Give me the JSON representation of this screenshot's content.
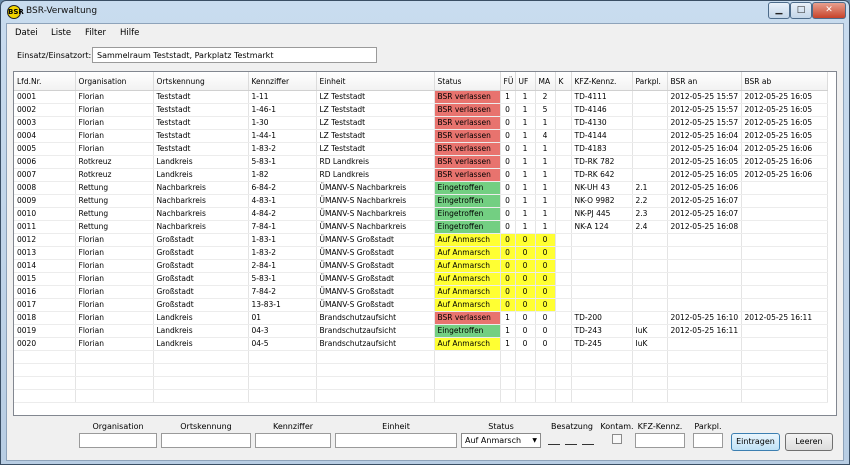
{
  "window": {
    "title": "BSR-Verwaltung",
    "app_icon_label": "BSR"
  },
  "menu": [
    "Datei",
    "Liste",
    "Filter",
    "Hilfe"
  ],
  "einsatz": {
    "label": "Einsatz/Einsatzort:",
    "value": "Sammelraum Teststadt, Parkplatz Testmarkt"
  },
  "table": {
    "columns": [
      "Lfd.Nr.",
      "Organisation",
      "Ortskennung",
      "Kennziffer",
      "Einheit",
      "Status",
      "FÜ",
      "UF",
      "MA",
      "K",
      "KFZ-Kennz.",
      "Parkpl.",
      "BSR an",
      "BSR ab"
    ],
    "rows": [
      {
        "nr": "0001",
        "org": "Florian",
        "ort": "Teststadt",
        "kz": "1-11",
        "einheit": "LZ Teststadt",
        "status": "BSR verlassen",
        "fue": "1",
        "uf": "1",
        "ma": "2",
        "k": "",
        "kfz": "TD-4111",
        "park": "",
        "an": "2012-05-25 15:57",
        "ab": "2012-05-25 16:05"
      },
      {
        "nr": "0002",
        "org": "Florian",
        "ort": "Teststadt",
        "kz": "1-46-1",
        "einheit": "LZ Teststadt",
        "status": "BSR verlassen",
        "fue": "0",
        "uf": "1",
        "ma": "5",
        "k": "",
        "kfz": "TD-4146",
        "park": "",
        "an": "2012-05-25 15:57",
        "ab": "2012-05-25 16:05"
      },
      {
        "nr": "0003",
        "org": "Florian",
        "ort": "Teststadt",
        "kz": "1-30",
        "einheit": "LZ Teststadt",
        "status": "BSR verlassen",
        "fue": "0",
        "uf": "1",
        "ma": "1",
        "k": "",
        "kfz": "TD-4130",
        "park": "",
        "an": "2012-05-25 15:57",
        "ab": "2012-05-25 16:05"
      },
      {
        "nr": "0004",
        "org": "Florian",
        "ort": "Teststadt",
        "kz": "1-44-1",
        "einheit": "LZ Teststadt",
        "status": "BSR verlassen",
        "fue": "0",
        "uf": "1",
        "ma": "4",
        "k": "",
        "kfz": "TD-4144",
        "park": "",
        "an": "2012-05-25 16:04",
        "ab": "2012-05-25 16:05"
      },
      {
        "nr": "0005",
        "org": "Florian",
        "ort": "Teststadt",
        "kz": "1-83-2",
        "einheit": "LZ Teststadt",
        "status": "BSR verlassen",
        "fue": "0",
        "uf": "1",
        "ma": "1",
        "k": "",
        "kfz": "TD-4183",
        "park": "",
        "an": "2012-05-25 16:04",
        "ab": "2012-05-25 16:06"
      },
      {
        "nr": "0006",
        "org": "Rotkreuz",
        "ort": "Landkreis",
        "kz": "5-83-1",
        "einheit": "RD Landkreis",
        "status": "BSR verlassen",
        "fue": "0",
        "uf": "1",
        "ma": "1",
        "k": "",
        "kfz": "TD-RK 782",
        "park": "",
        "an": "2012-05-25 16:05",
        "ab": "2012-05-25 16:06"
      },
      {
        "nr": "0007",
        "org": "Rotkreuz",
        "ort": "Landkreis",
        "kz": "1-82",
        "einheit": "RD Landkreis",
        "status": "BSR verlassen",
        "fue": "0",
        "uf": "1",
        "ma": "1",
        "k": "",
        "kfz": "TD-RK 642",
        "park": "",
        "an": "2012-05-25 16:05",
        "ab": "2012-05-25 16:06"
      },
      {
        "nr": "0008",
        "org": "Rettung",
        "ort": "Nachbarkreis",
        "kz": "6-84-2",
        "einheit": "ÜMANV-S Nachbarkreis",
        "status": "Eingetroffen",
        "fue": "0",
        "uf": "1",
        "ma": "1",
        "k": "",
        "kfz": "NK-UH 43",
        "park": "2.1",
        "an": "2012-05-25 16:06",
        "ab": ""
      },
      {
        "nr": "0009",
        "org": "Rettung",
        "ort": "Nachbarkreis",
        "kz": "4-83-1",
        "einheit": "ÜMANV-S Nachbarkreis",
        "status": "Eingetroffen",
        "fue": "0",
        "uf": "1",
        "ma": "1",
        "k": "",
        "kfz": "NK-O 9982",
        "park": "2.2",
        "an": "2012-05-25 16:07",
        "ab": ""
      },
      {
        "nr": "0010",
        "org": "Rettung",
        "ort": "Nachbarkreis",
        "kz": "4-84-2",
        "einheit": "ÜMANV-S Nachbarkreis",
        "status": "Eingetroffen",
        "fue": "0",
        "uf": "1",
        "ma": "1",
        "k": "",
        "kfz": "NK-PJ 445",
        "park": "2.3",
        "an": "2012-05-25 16:07",
        "ab": ""
      },
      {
        "nr": "0011",
        "org": "Rettung",
        "ort": "Nachbarkreis",
        "kz": "7-84-1",
        "einheit": "ÜMANV-S Nachbarkreis",
        "status": "Eingetroffen",
        "fue": "0",
        "uf": "1",
        "ma": "1",
        "k": "",
        "kfz": "NK-A 124",
        "park": "2.4",
        "an": "2012-05-25 16:08",
        "ab": ""
      },
      {
        "nr": "0012",
        "org": "Florian",
        "ort": "Großstadt",
        "kz": "1-83-1",
        "einheit": "ÜMANV-S Großstadt",
        "status": "Auf Anmarsch",
        "fue": "0",
        "uf": "0",
        "ma": "0",
        "k": "",
        "kfz": "",
        "park": "",
        "an": "",
        "ab": ""
      },
      {
        "nr": "0013",
        "org": "Florian",
        "ort": "Großstadt",
        "kz": "1-83-2",
        "einheit": "ÜMANV-S Großstadt",
        "status": "Auf Anmarsch",
        "fue": "0",
        "uf": "0",
        "ma": "0",
        "k": "",
        "kfz": "",
        "park": "",
        "an": "",
        "ab": ""
      },
      {
        "nr": "0014",
        "org": "Florian",
        "ort": "Großstadt",
        "kz": "2-84-1",
        "einheit": "ÜMANV-S Großstadt",
        "status": "Auf Anmarsch",
        "fue": "0",
        "uf": "0",
        "ma": "0",
        "k": "",
        "kfz": "",
        "park": "",
        "an": "",
        "ab": ""
      },
      {
        "nr": "0015",
        "org": "Florian",
        "ort": "Großstadt",
        "kz": "5-83-1",
        "einheit": "ÜMANV-S Großstadt",
        "status": "Auf Anmarsch",
        "fue": "0",
        "uf": "0",
        "ma": "0",
        "k": "",
        "kfz": "",
        "park": "",
        "an": "",
        "ab": ""
      },
      {
        "nr": "0016",
        "org": "Florian",
        "ort": "Großstadt",
        "kz": "7-84-2",
        "einheit": "ÜMANV-S Großstadt",
        "status": "Auf Anmarsch",
        "fue": "0",
        "uf": "0",
        "ma": "0",
        "k": "",
        "kfz": "",
        "park": "",
        "an": "",
        "ab": ""
      },
      {
        "nr": "0017",
        "org": "Florian",
        "ort": "Großstadt",
        "kz": "13-83-1",
        "einheit": "ÜMANV-S Großstadt",
        "status": "Auf Anmarsch",
        "fue": "0",
        "uf": "0",
        "ma": "0",
        "k": "",
        "kfz": "",
        "park": "",
        "an": "",
        "ab": ""
      },
      {
        "nr": "0018",
        "org": "Florian",
        "ort": "Landkreis",
        "kz": "01",
        "einheit": "Brandschutzaufsicht",
        "status": "BSR verlassen",
        "fue": "1",
        "uf": "0",
        "ma": "0",
        "k": "",
        "kfz": "TD-200",
        "park": "",
        "an": "2012-05-25 16:10",
        "ab": "2012-05-25 16:11"
      },
      {
        "nr": "0019",
        "org": "Florian",
        "ort": "Landkreis",
        "kz": "04-3",
        "einheit": "Brandschutzaufsicht",
        "status": "Eingetroffen",
        "fue": "1",
        "uf": "0",
        "ma": "0",
        "k": "",
        "kfz": "TD-243",
        "park": "IuK",
        "an": "2012-05-25 16:11",
        "ab": ""
      },
      {
        "nr": "0020",
        "org": "Florian",
        "ort": "Landkreis",
        "kz": "04-5",
        "einheit": "Brandschutzaufsicht",
        "status": "Auf Anmarsch",
        "fue": "1",
        "uf": "0",
        "ma": "0",
        "k": "",
        "kfz": "TD-245",
        "park": "IuK",
        "an": "",
        "ab": ""
      }
    ]
  },
  "status_colors": {
    "BSR verlassen": "#e8736e",
    "Eingetroffen": "#73cf82",
    "Auf Anmarsch": "#ffff33"
  },
  "form": {
    "labels": {
      "organisation": "Organisation",
      "ortskennung": "Ortskennung",
      "kennziffer": "Kennziffer",
      "einheit": "Einheit",
      "status": "Status",
      "besatzung": "Besatzung",
      "kontam": "Kontam.",
      "kfz": "KFZ-Kennz.",
      "parkpl": "Parkpl."
    },
    "status_value": "Auf Anmarsch",
    "buttons": {
      "eintragen": "Eintragen",
      "leeren": "Leeren"
    }
  }
}
